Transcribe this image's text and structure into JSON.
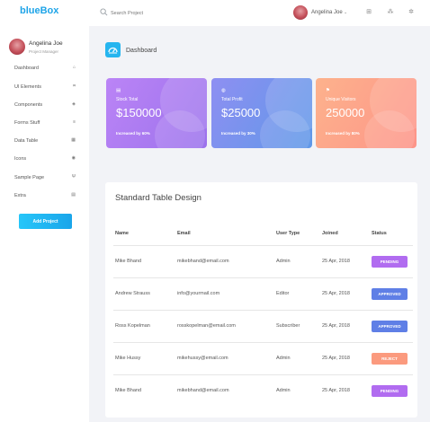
{
  "brand": "blueBox",
  "search": {
    "placeholder": "Search Project"
  },
  "topbar": {
    "user_name": "Angelina Joe",
    "caret": "⌄"
  },
  "profile": {
    "name": "Angelina Joe",
    "role": "Project Manager"
  },
  "nav": [
    {
      "label": "Dashboard",
      "icon": "home-icon",
      "glyph": "⌂"
    },
    {
      "label": "UI Elements",
      "icon": "grid-icon",
      "glyph": "⌗"
    },
    {
      "label": "Components",
      "icon": "puzzle-icon",
      "glyph": "◈"
    },
    {
      "label": "Forms Stuff",
      "icon": "list-icon",
      "glyph": "≡"
    },
    {
      "label": "Data Table",
      "icon": "table-icon",
      "glyph": "▦"
    },
    {
      "label": "Icons",
      "icon": "eye-icon",
      "glyph": "◉"
    },
    {
      "label": "Sample Page",
      "icon": "link-icon",
      "glyph": "Ψ"
    },
    {
      "label": "Extra",
      "icon": "file-icon",
      "glyph": "▤"
    }
  ],
  "add_project": "Add Project",
  "page_title": "Dashboard",
  "stats": [
    {
      "label": "Stock Total",
      "value": "$150000",
      "increase": "Increased by 60%",
      "icon": "chart-icon",
      "glyph": "▤"
    },
    {
      "label": "Total Profit",
      "value": "$25000",
      "increase": "Increased by 30%",
      "icon": "bag-icon",
      "glyph": "◍"
    },
    {
      "label": "Unique Visitors",
      "value": "250000",
      "increase": "Increased by 80%",
      "icon": "flag-icon",
      "glyph": "⚑"
    }
  ],
  "table": {
    "title": "Standard Table Design",
    "headers": [
      "Name",
      "Email",
      "User Type",
      "Joined",
      "Status"
    ],
    "rows": [
      {
        "name": "Mike Bhand",
        "email": "mikebhand@email.com",
        "type": "Admin",
        "joined": "25 Apr, 2018",
        "status": "PENDING",
        "color": "#b16cf0"
      },
      {
        "name": "Andrew Strauss",
        "email": "info@yourmail.com",
        "type": "Editor",
        "joined": "25 Apr, 2018",
        "status": "APPROVED",
        "color": "#5f7fe6"
      },
      {
        "name": "Ross Kopelman",
        "email": "rosskopelman@email.com",
        "type": "Subscriber",
        "joined": "25 Apr, 2018",
        "status": "APPROVED",
        "color": "#5f7fe6"
      },
      {
        "name": "Mike Hussy",
        "email": "mikehussy@email.com",
        "type": "Admin",
        "joined": "25 Apr, 2018",
        "status": "REJECT",
        "color": "#fb9a7e"
      },
      {
        "name": "Mike Bhand",
        "email": "mikebhand@email.com",
        "type": "Admin",
        "joined": "25 Apr, 2018",
        "status": "PENDING",
        "color": "#b16cf0"
      }
    ]
  },
  "colors": {
    "brand": "#1ea4e8",
    "accent": "#26b5ef"
  }
}
